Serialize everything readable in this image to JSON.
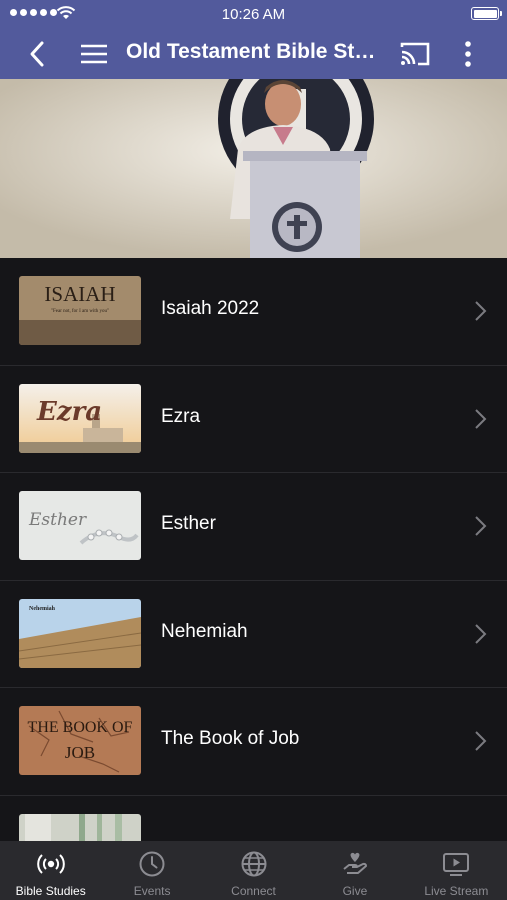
{
  "status": {
    "time": "10:26 AM"
  },
  "nav": {
    "title": "Old Testament Bible Stu..."
  },
  "items": [
    {
      "label": "Isaiah 2022",
      "thumb_text": "ISAIAH",
      "thumb_subtext": "\"Fear not, for I am with you\""
    },
    {
      "label": "Ezra",
      "thumb_text": "Ezra"
    },
    {
      "label": "Esther",
      "thumb_text": "Esther"
    },
    {
      "label": "Nehemiah",
      "thumb_text": "Nehemiah"
    },
    {
      "label": "The Book of Job",
      "thumb_text": "THE BOOK OF",
      "thumb_text2": "JOB"
    },
    {
      "label": ""
    }
  ],
  "tabs": [
    {
      "label": "Bible Studies",
      "icon": "broadcast-icon",
      "active": true
    },
    {
      "label": "Events",
      "icon": "clock-icon",
      "active": false
    },
    {
      "label": "Connect",
      "icon": "globe-icon",
      "active": false
    },
    {
      "label": "Give",
      "icon": "give-hand-icon",
      "active": false
    },
    {
      "label": "Live Stream",
      "icon": "play-screen-icon",
      "active": false
    }
  ],
  "colors": {
    "nav_bg": "#525a9c",
    "list_bg": "#151518",
    "tab_bg": "#2a2a2e",
    "tab_inactive": "#8c8c92"
  }
}
